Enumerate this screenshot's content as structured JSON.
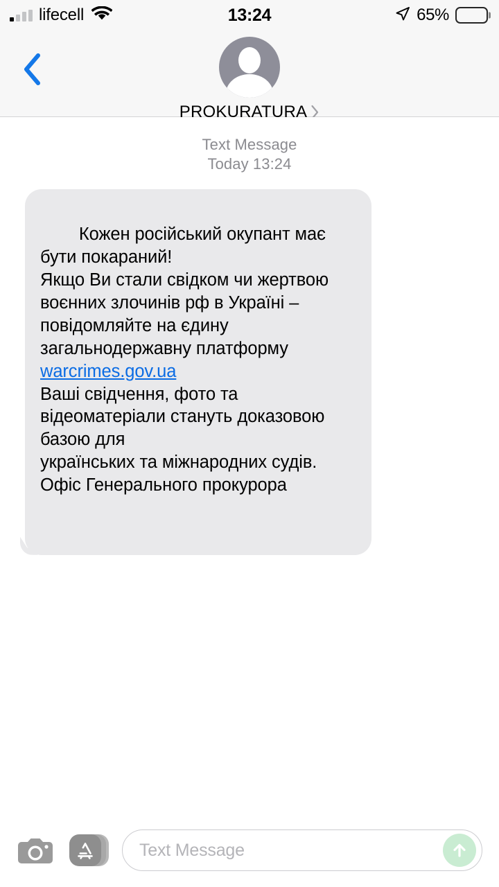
{
  "status_bar": {
    "carrier": "lifecell",
    "time": "13:24",
    "battery_percent": "65%",
    "battery_level": 65,
    "signal_bars_filled": 1,
    "signal_bars_total": 4,
    "icons": {
      "signal": "cellular-signal-icon",
      "wifi": "wifi-icon",
      "location": "location-arrow-icon",
      "battery": "battery-icon"
    }
  },
  "nav_header": {
    "back_icon": "chevron-left-icon",
    "avatar": "contact-avatar-placeholder",
    "contact_name": "PROKURATURA",
    "detail_chevron": "chevron-right-icon"
  },
  "conversation": {
    "meta_type": "Text Message",
    "meta_time": "Today 13:24",
    "message": {
      "sender": "incoming",
      "text_before_link": "Кожен російський окупант має бути покараний!\nЯкщо Ви стали свідком чи жертвою воєнних злочинів рф в Україні – повідомляйте на єдину загальнодержавну платформу\n",
      "link_text": "warcrimes.gov.ua",
      "text_after_link": "\nВаші свідчення, фото та відеоматеріали стануть доказовою базою для\nукраїнських та міжнародних судів.\nОфіс Генерального прокурора"
    }
  },
  "input_bar": {
    "camera_icon": "camera-icon",
    "apps_icon": "app-store-icon",
    "placeholder": "Text Message",
    "send_icon": "arrow-up-icon"
  },
  "colors": {
    "accent_blue": "#007AFF",
    "link_blue": "#0b6ce4",
    "bubble_gray": "#e9e9eb",
    "header_gray": "#f7f7f7",
    "avatar_gray": "#8e8e99",
    "send_green": "#c9ecd2",
    "meta_gray": "#8b8b90"
  }
}
